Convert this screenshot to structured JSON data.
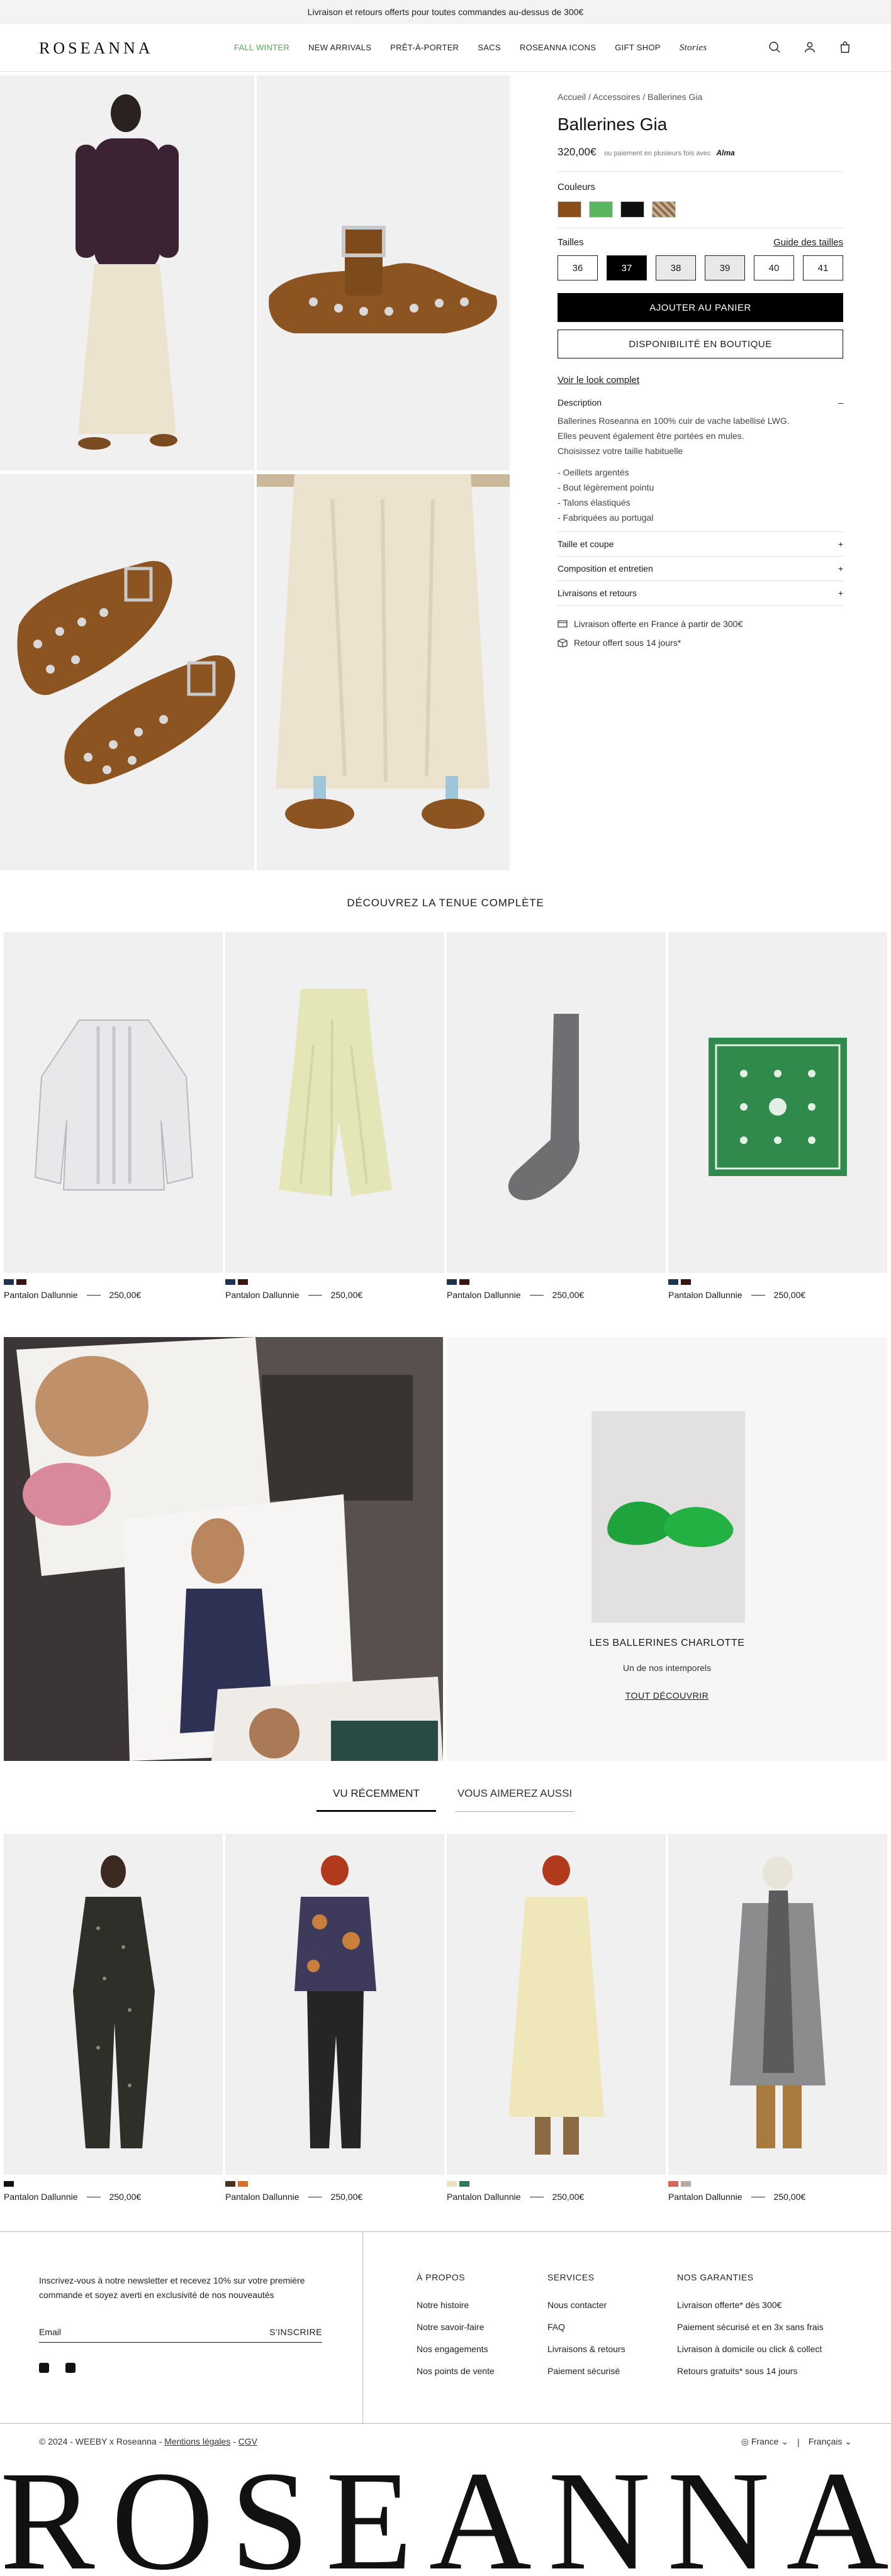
{
  "banner": {
    "text": "Livraison et retours offerts pour toutes commandes au-dessus de 300€"
  },
  "header": {
    "logo": "ROSEANNA",
    "nav": [
      "FALL WINTER",
      "NEW ARRIVALS",
      "PRÊT-À-PORTER",
      "SACS",
      "ROSEANNA ICONS",
      "GIFT SHOP",
      "Stories"
    ],
    "icons": [
      "search-icon",
      "account-icon",
      "bag-icon"
    ]
  },
  "product": {
    "breadcrumb": "Accueil / Accessoires / Ballerines Gia",
    "title": "Ballerines Gia",
    "price": "320,00€",
    "installments": "ou paiement en plusieurs fois avec",
    "installments_brand": "Alma",
    "colors_label": "Couleurs",
    "colors": [
      "#8b4f1b",
      "#5ab65f",
      "#0f0f0f",
      "#a58e72"
    ],
    "sizes_label": "Tailles",
    "size_guide": "Guide des tailles",
    "sizes": [
      "36",
      "37",
      "38",
      "39",
      "40",
      "41"
    ],
    "selected_size": "37",
    "unavailable_sizes": [
      "38",
      "39"
    ],
    "add_to_cart": "AJOUTER AU PANIER",
    "store_availability": "DISPONIBILITÉ EN BOUTIQUE",
    "complete_look": "Voir le look complet",
    "description_title": "Description",
    "description_lines": [
      "Ballerines Roseanna en 100% cuir de vache labellisé LWG.",
      "Elles peuvent également être portées en mules.",
      "Choisissez votre taille habituelle"
    ],
    "features": [
      "- Oeillets argentés",
      "- Bout légèrement pointu",
      "- Talons élastiqués",
      "- Fabriquées au portugal"
    ],
    "accordions": [
      "Taille et coupe",
      "Composition et entretien",
      "Livraisons et retours"
    ],
    "perks": [
      "Livraison offerte en France à partir de 300€",
      "Retour offert sous 14 jours*"
    ]
  },
  "complete_look": {
    "title": "DÉCOUVREZ LA TENUE COMPLÈTE",
    "items": [
      {
        "name": "Pantalon Dallunnie",
        "price": "250,00€",
        "colors": [
          "#1f3350",
          "#3b1414"
        ]
      },
      {
        "name": "Pantalon Dallunnie",
        "price": "250,00€",
        "colors": [
          "#1f3350",
          "#3b1414"
        ]
      },
      {
        "name": "Pantalon Dallunnie",
        "price": "250,00€",
        "colors": [
          "#1f3350",
          "#3b1414"
        ]
      },
      {
        "name": "Pantalon Dallunnie",
        "price": "250,00€",
        "colors": [
          "#1f3350",
          "#3b1414"
        ]
      }
    ]
  },
  "promo": {
    "title": "LES BALLERINES CHARLOTTE",
    "subtitle": "Un de nos intemporels",
    "cta": "TOUT DÉCOUVRIR"
  },
  "tabs": {
    "recent": "VU RÉCEMMENT",
    "suggest": "VOUS AIMEREZ AUSSI"
  },
  "recent": {
    "items": [
      {
        "name": "Pantalon Dallunnie",
        "price": "250,00€",
        "colors": [
          "#111111"
        ]
      },
      {
        "name": "Pantalon Dallunnie",
        "price": "250,00€",
        "colors": [
          "#4a3220",
          "#d0722d"
        ]
      },
      {
        "name": "Pantalon Dallunnie",
        "price": "250,00€",
        "colors": [
          "#ece3b8",
          "#2f7a56"
        ]
      },
      {
        "name": "Pantalon Dallunnie",
        "price": "250,00€",
        "colors": [
          "#d0675a",
          "#b9a9a0"
        ]
      }
    ]
  },
  "footer": {
    "newsletter": "Inscrivez-vous à notre newsletter et recevez 10% sur votre première commande et soyez averti en exclusivité de nos nouveautés",
    "email_placeholder": "Email",
    "subscribe": "S'INSCRIRE",
    "columns": [
      {
        "heading": "À PROPOS",
        "links": [
          "Notre histoire",
          "Notre savoir-faire",
          "Nos engagements",
          "Nos points de vente"
        ]
      },
      {
        "heading": "SERVICES",
        "links": [
          "Nous contacter",
          "FAQ",
          "Livraisons & retours",
          "Paiement sécurisé"
        ]
      },
      {
        "heading": "NOS GARANTIES",
        "links": [
          "Livraison offerte* dès 300€",
          "Paiement sécurisé et en 3x sans frais",
          "Livraison à domicile ou click & collect",
          "Retours gratuits* sous 14 jours"
        ]
      }
    ],
    "copyright": "© 2024 - WEEBY x Roseanna -",
    "legal_mentions": "Mentions légales",
    "cgv": "CGV",
    "country": "France",
    "language": "Français",
    "big_logo": "ROSEANNA"
  }
}
